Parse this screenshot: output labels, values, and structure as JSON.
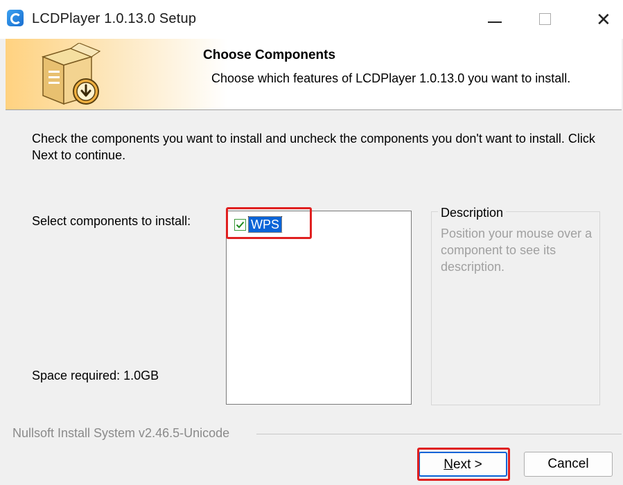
{
  "window": {
    "title": "LCDPlayer 1.0.13.0 Setup",
    "minimize_glyph": "—",
    "close_glyph": "✕"
  },
  "header": {
    "title": "Choose Components",
    "subtitle": "Choose which features of LCDPlayer 1.0.13.0 you want to install."
  },
  "body": {
    "intro": "Check the components you want to install and uncheck the components you don't want to install. Click Next to continue.",
    "select_label": "Select components to install:",
    "components": [
      {
        "label": "WPS",
        "checked": true,
        "selected": true
      }
    ],
    "space_required": "Space required: 1.0GB"
  },
  "description": {
    "title": "Description",
    "text": "Position your mouse over a component to see its description."
  },
  "footer": {
    "branding": "Nullsoft Install System v2.46.5-Unicode",
    "next_mnemonic": "N",
    "next_rest": "ext >",
    "cancel_label": "Cancel"
  },
  "colors": {
    "highlight": "#e02020",
    "selection": "#0a64d8",
    "checkmark": "#1e8c1e"
  },
  "icons": {
    "app": "lcdplayer-app-icon",
    "header": "installer-box-download-icon"
  }
}
